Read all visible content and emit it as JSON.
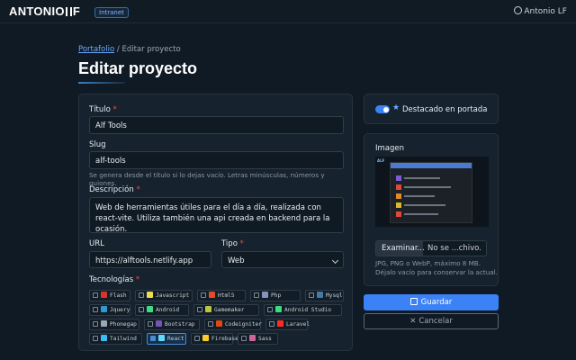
{
  "header": {
    "logo_left": "ANTONIO",
    "logo_right": "F",
    "badge": "Intranet",
    "user_name": "Antonio LF"
  },
  "breadcrumb": {
    "link": "Portafolio",
    "separator": "/",
    "current": "Editar proyecto"
  },
  "page_title": "Editar proyecto",
  "form": {
    "titulo": {
      "label": "Título",
      "required": "*",
      "value": "Alf Tools"
    },
    "slug": {
      "label": "Slug",
      "value": "alf-tools",
      "help": "Se genera desde el título si lo dejas vacío. Letras minúsculas, números y guiones."
    },
    "descripcion": {
      "label": "Descripción",
      "required": "*",
      "value": "Web de herramientas útiles para el día a día, realizada con react-vite. Utiliza también una api creada en backend para la ocasión."
    },
    "url": {
      "label": "URL",
      "value": "https://alftools.netlify.app"
    },
    "tipo": {
      "label": "Tipo",
      "required": "*",
      "value": "Web"
    },
    "tecnologias": {
      "label": "Tecnologías",
      "required": "*",
      "items": [
        {
          "label": "Flash",
          "icon": "flash-icon",
          "color": "#d9342b",
          "checked": false
        },
        {
          "label": "Javascript",
          "icon": "javascript-icon",
          "color": "#f0db4f",
          "checked": false
        },
        {
          "label": "Html5",
          "icon": "html5-icon",
          "color": "#e34c26",
          "checked": false
        },
        {
          "label": "Php",
          "icon": "php-icon",
          "color": "#8892be",
          "checked": false
        },
        {
          "label": "Mysql",
          "icon": "mysql-icon",
          "color": "#4479a1",
          "checked": false
        },
        {
          "label": "Jquery",
          "icon": "jquery-icon",
          "color": "#2b9bd6",
          "checked": false
        },
        {
          "label": "Android",
          "icon": "android-icon",
          "color": "#3ddc84",
          "checked": false
        },
        {
          "label": "Gamemaker",
          "icon": "gamemaker-icon",
          "color": "#b9c441",
          "checked": false
        },
        {
          "label": "Android Studio",
          "icon": "android-studio-icon",
          "color": "#3ddc84",
          "checked": false
        },
        {
          "label": "Phonegap",
          "icon": "phonegap-icon",
          "color": "#9aa7b4",
          "checked": false
        },
        {
          "label": "Bootstrap",
          "icon": "bootstrap-icon",
          "color": "#7952b3",
          "checked": false
        },
        {
          "label": "Codeigniter",
          "icon": "codeigniter-icon",
          "color": "#dd4814",
          "checked": false
        },
        {
          "label": "Laravel",
          "icon": "laravel-icon",
          "color": "#ff2d20",
          "checked": false
        },
        {
          "label": "Tailwind",
          "icon": "tailwind-icon",
          "color": "#38bdf8",
          "checked": false
        },
        {
          "label": "React",
          "icon": "react-icon",
          "color": "#61dafb",
          "checked": true
        },
        {
          "label": "Firebase",
          "icon": "firebase-icon",
          "color": "#ffca28",
          "checked": false
        },
        {
          "label": "Sass",
          "icon": "sass-icon",
          "color": "#cc6699",
          "checked": false
        }
      ]
    }
  },
  "sidebar": {
    "featured_label": "Destacado en portada",
    "featured_on": true,
    "image_label": "Imagen",
    "file_button": "Examinar...",
    "file_status": "No se ...chivo.",
    "image_help_1": "JPG, PNG o WebP, máximo 8 MB.",
    "image_help_2": "Déjalo vacío para conservar la actual.",
    "preview_logo": "ALF"
  },
  "actions": {
    "save": "Guardar",
    "cancel": "Cancelar"
  },
  "colors": {
    "accent": "#3b82f6",
    "required": "#e5534b",
    "background": "#0f1a24"
  }
}
